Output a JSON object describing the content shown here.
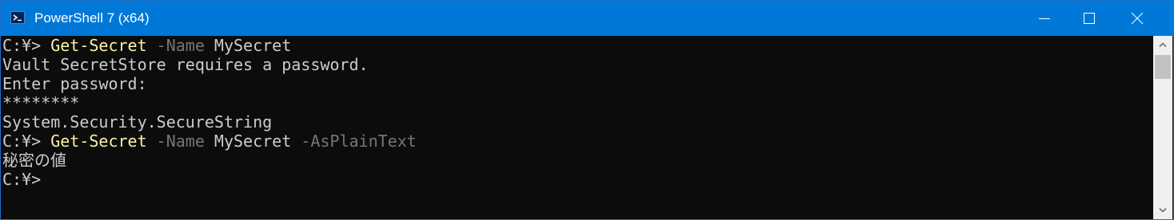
{
  "window": {
    "title": "PowerShell 7 (x64)",
    "icon": "powershell-icon",
    "controls": [
      "minimize-icon",
      "maximize-icon",
      "close-icon"
    ],
    "accent": "#0078d7"
  },
  "console": {
    "background": "#0c0c0c",
    "lines": [
      {
        "prompt": "C:¥> ",
        "command": "Get-Secret",
        "param1": " -Name",
        "arg1": " MySecret",
        "param2": ""
      },
      {
        "text": "Vault SecretStore requires a password."
      },
      {
        "text": "Enter password:"
      },
      {
        "text": "********"
      },
      {
        "text": "System.Security.SecureString"
      },
      {
        "prompt": "C:¥> ",
        "command": "Get-Secret",
        "param1": " -Name",
        "arg1": " MySecret",
        "param2": " -AsPlainText"
      },
      {
        "text": "秘密の値"
      },
      {
        "prompt": "C:¥>"
      }
    ],
    "colors": {
      "command": "#f9f1a5",
      "parameter": "#767676",
      "text": "#cccccc"
    }
  },
  "scrollbar": {
    "up_icon": "chevron-up-icon",
    "down_icon": "chevron-down-icon"
  }
}
